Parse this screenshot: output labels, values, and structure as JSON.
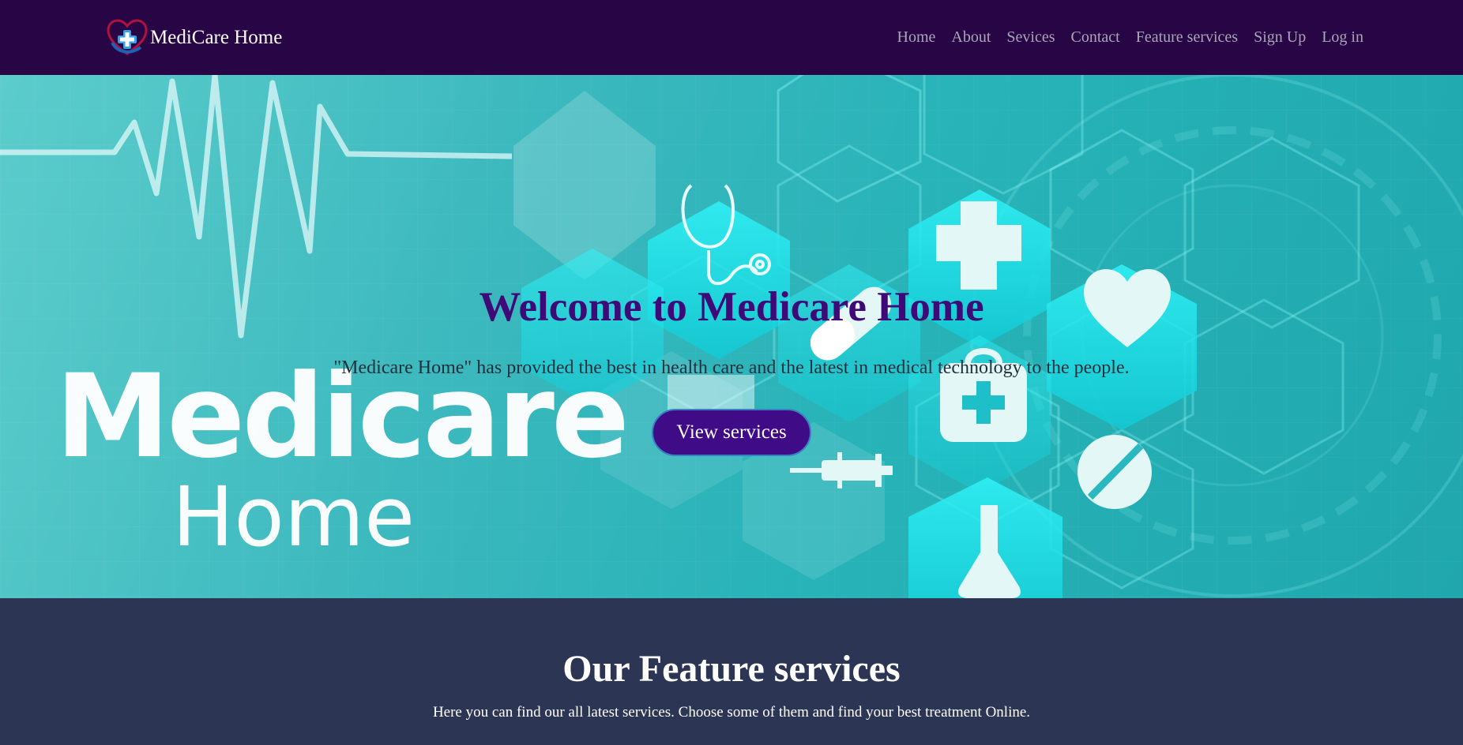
{
  "brand": {
    "name": "MediCare Home",
    "logo_icon": "heart-cross-logo-icon"
  },
  "nav": {
    "links": [
      "Home",
      "About",
      "Sevices",
      "Contact",
      "Feature services",
      "Sign Up",
      "Log in"
    ]
  },
  "hero": {
    "title": "Welcome to Medicare Home",
    "text": "\"Medicare Home\" has provided the best in health care and the latest in medical technology to the people.",
    "button": "View services",
    "wordmark": {
      "line1": "Medicare",
      "line2": "Home"
    },
    "background_icons": [
      "heartbeat-line-icon",
      "stethoscope-icon",
      "plus-cross-icon",
      "capsule-icon",
      "heart-icon",
      "medical-bag-icon",
      "syringe-icon",
      "pill-icon",
      "flask-icon"
    ]
  },
  "features": {
    "title": "Our Feature services",
    "subtitle": "Here you can find our all latest services. Choose some of them and find your best treatment Online."
  },
  "colors": {
    "navbar": "#280545",
    "hero_title": "#3d0a78",
    "button": "#3f0b86",
    "features_bg": "#2c3553"
  }
}
